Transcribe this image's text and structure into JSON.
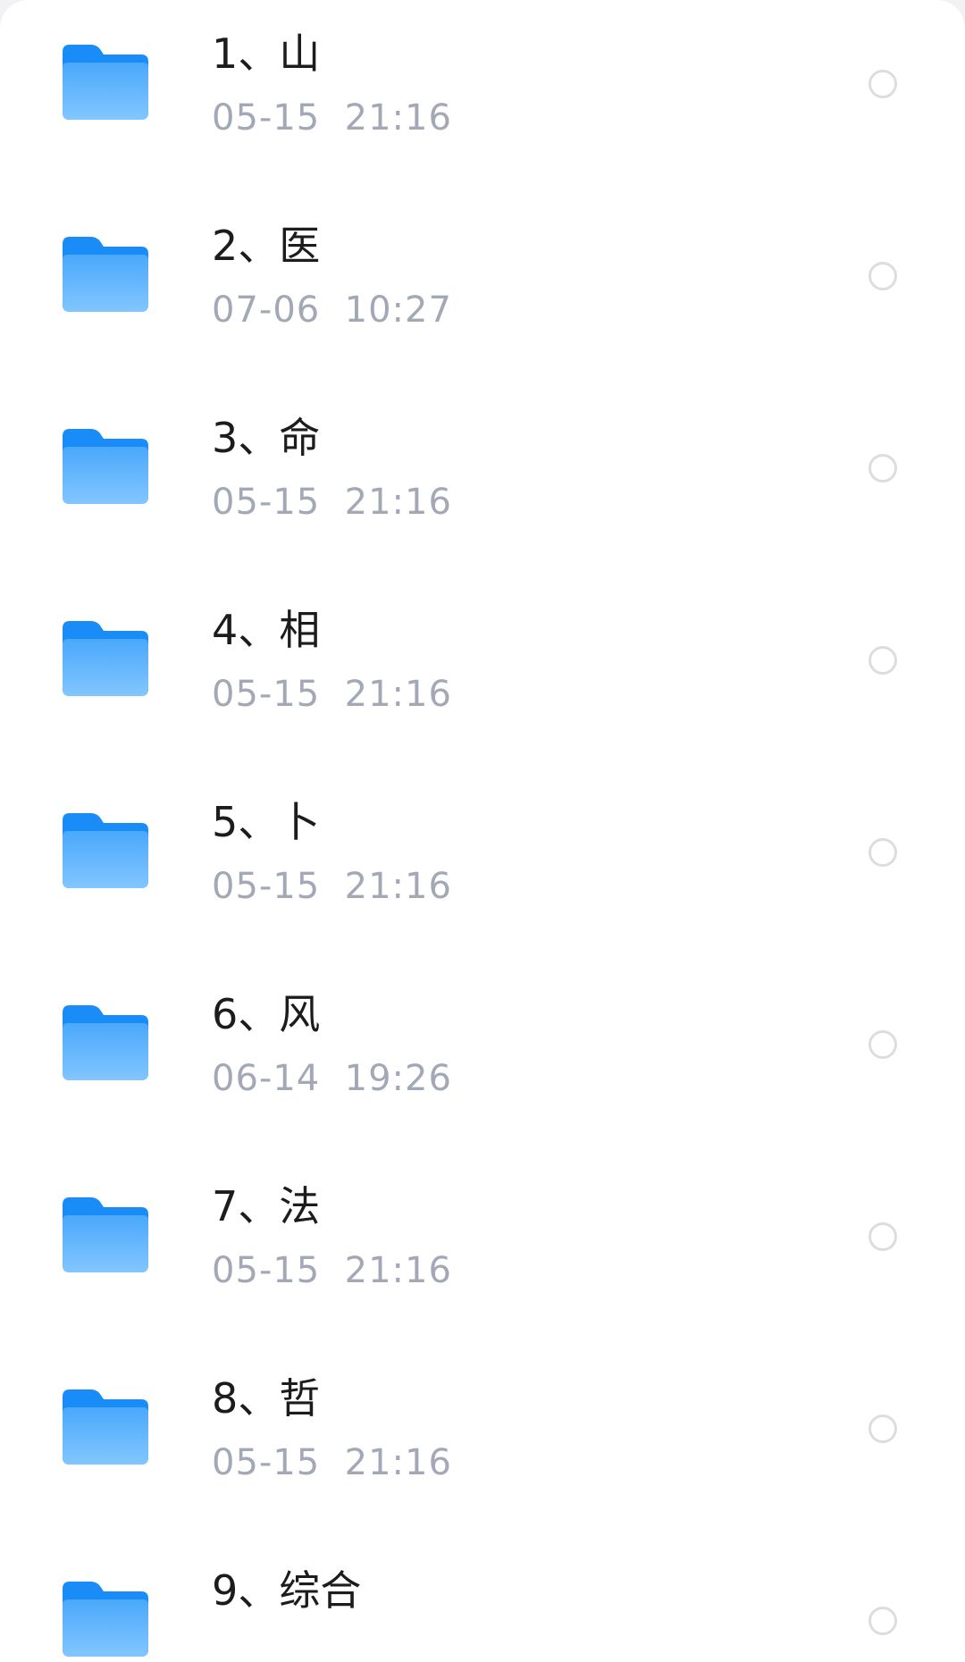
{
  "folder_list": {
    "items": [
      {
        "name": "1、山",
        "date": "05-15  21:16"
      },
      {
        "name": "2、医",
        "date": "07-06  10:27"
      },
      {
        "name": "3、命",
        "date": "05-15  21:16"
      },
      {
        "name": "4、相",
        "date": "05-15  21:16"
      },
      {
        "name": "5、卜",
        "date": "05-15  21:16"
      },
      {
        "name": "6、风",
        "date": "06-14  19:26"
      },
      {
        "name": "7、法",
        "date": "05-15  21:16"
      },
      {
        "name": "8、哲",
        "date": "05-15  21:16"
      },
      {
        "name": "9、综合",
        "date": ""
      }
    ]
  },
  "colors": {
    "folder_back": "#1a8cf7",
    "folder_front_top": "#4aa8fb",
    "folder_front_bottom": "#82c6ff",
    "date_text": "#a3a8b6",
    "radio_border": "#dcdde0"
  },
  "icons": {
    "folder": "folder-icon",
    "select": "radio-circle-icon"
  }
}
